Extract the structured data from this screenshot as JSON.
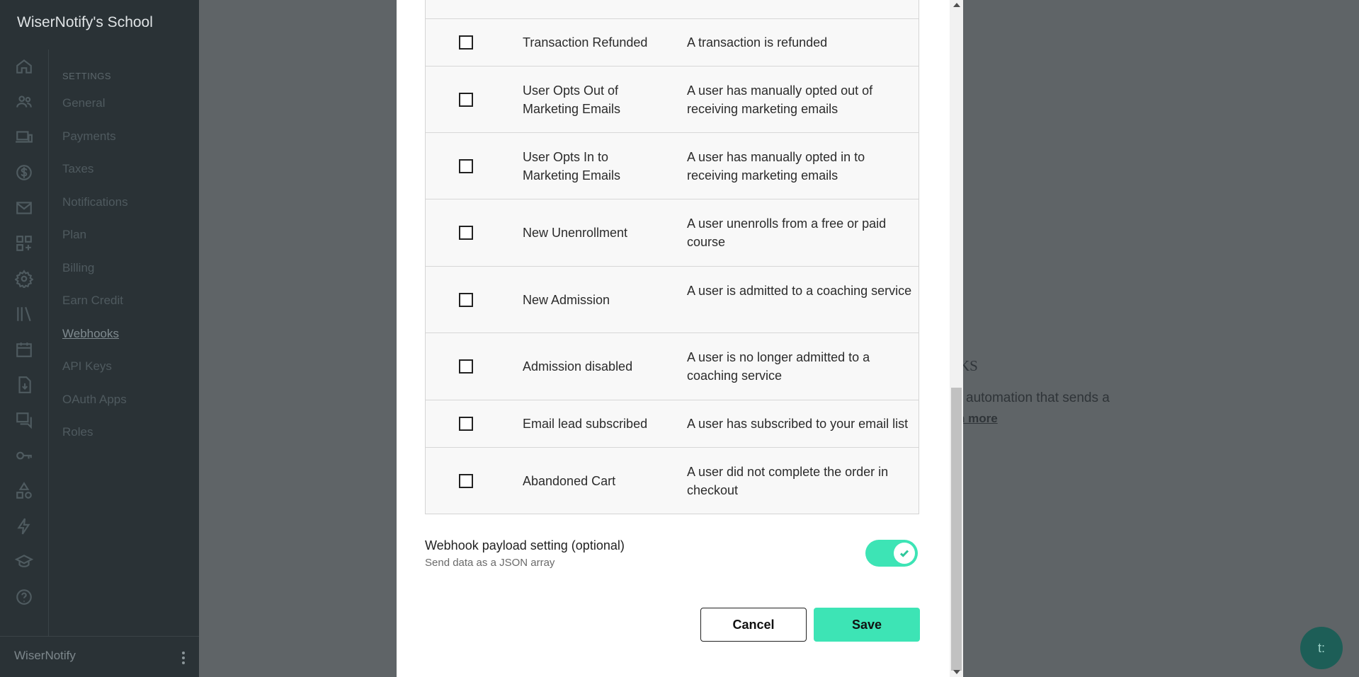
{
  "sidebar": {
    "brand": "WiserNotify's School",
    "section_heading": "SETTINGS",
    "items": [
      {
        "label": "General"
      },
      {
        "label": "Payments"
      },
      {
        "label": "Taxes"
      },
      {
        "label": "Notifications"
      },
      {
        "label": "Plan"
      },
      {
        "label": "Billing"
      },
      {
        "label": "Earn Credit"
      },
      {
        "label": "Webhooks",
        "active": true
      },
      {
        "label": "API Keys"
      },
      {
        "label": "OAuth Apps"
      },
      {
        "label": "Roles"
      }
    ],
    "rail_icons": [
      "home-icon",
      "users-icon",
      "devices-icon",
      "dollar-icon",
      "mail-icon",
      "apps-add-icon",
      "gear-icon",
      "library-icon",
      "calendar-icon",
      "download-doc-icon",
      "chat-icon",
      "key-icon",
      "shapes-icon",
      "bolt-icon",
      "graduation-cap-icon",
      "help-icon"
    ],
    "footer_name": "WiserNotify"
  },
  "background": {
    "heading_fragment": "KS",
    "text_fragment": "automation that sends a",
    "link_fragment": "n more"
  },
  "modal": {
    "events": [
      {
        "name": "Transaction Refunded",
        "description": "A transaction is refunded"
      },
      {
        "name": "User Opts Out of Marketing Emails",
        "description": "A user has manually opted out of receiving marketing emails"
      },
      {
        "name": "User Opts In to Marketing Emails",
        "description": "A user has manually opted in to receiving marketing emails"
      },
      {
        "name": "New Unenrollment",
        "description": "A user unenrolls from a free or paid course"
      },
      {
        "name": "New Admission",
        "description": "A user is admitted to a coaching service"
      },
      {
        "name": "Admission disabled",
        "description": "A user is no longer admitted to a coaching service"
      },
      {
        "name": "Email lead subscribed",
        "description": "A user has subscribed to your email list"
      },
      {
        "name": "Abandoned Cart",
        "description": "A user did not complete the order in checkout"
      }
    ],
    "payload": {
      "title": "Webhook payload setting (optional)",
      "subtitle": "Send data as a JSON array",
      "enabled": true
    },
    "cancel_label": "Cancel",
    "save_label": "Save"
  },
  "colors": {
    "accent": "#3de4b5",
    "sidebar_bg": "#2a3236",
    "overlay": "#5f6467"
  },
  "chat_widget_glyph": "t:"
}
